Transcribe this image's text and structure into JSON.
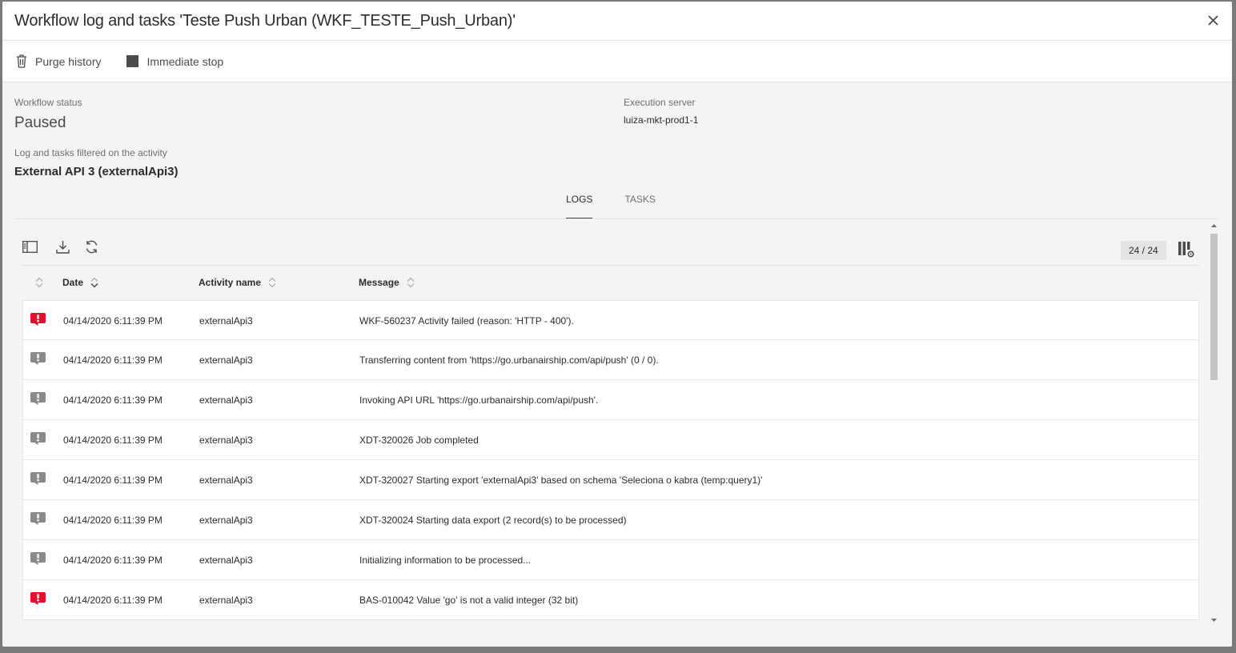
{
  "dialog": {
    "title": "Workflow log and tasks 'Teste Push Urban (WKF_TESTE_Push_Urban)'"
  },
  "toolbar": {
    "purge_label": "Purge history",
    "stop_label": "Immediate stop"
  },
  "info": {
    "status_label": "Workflow status",
    "status_value": "Paused",
    "server_label": "Execution server",
    "server_value": "luiza-mkt-prod1-1",
    "filter_label": "Log and tasks filtered on the activity",
    "filter_value": "External API 3 (externalApi3)"
  },
  "tabs": [
    {
      "label": "LOGS",
      "active": true
    },
    {
      "label": "TASKS",
      "active": false
    }
  ],
  "grid": {
    "count": "24 / 24",
    "columns": {
      "date": "Date",
      "activity": "Activity name",
      "message": "Message"
    },
    "rows": [
      {
        "level": "error",
        "date": "04/14/2020 6:11:39 PM",
        "activity": "externalApi3",
        "message": "WKF-560237 Activity failed (reason: 'HTTP - 400')."
      },
      {
        "level": "info",
        "date": "04/14/2020 6:11:39 PM",
        "activity": "externalApi3",
        "message": "Transferring content from 'https://go.urbanairship.com/api/push' (0 / 0)."
      },
      {
        "level": "info",
        "date": "04/14/2020 6:11:39 PM",
        "activity": "externalApi3",
        "message": "Invoking API URL 'https://go.urbanairship.com/api/push'."
      },
      {
        "level": "info",
        "date": "04/14/2020 6:11:39 PM",
        "activity": "externalApi3",
        "message": "XDT-320026 Job completed"
      },
      {
        "level": "info",
        "date": "04/14/2020 6:11:39 PM",
        "activity": "externalApi3",
        "message": "XDT-320027 Starting export 'externalApi3' based on schema 'Seleciona o kabra (temp:query1)'"
      },
      {
        "level": "info",
        "date": "04/14/2020 6:11:39 PM",
        "activity": "externalApi3",
        "message": "XDT-320024 Starting data export (2 record(s) to be processed)"
      },
      {
        "level": "info",
        "date": "04/14/2020 6:11:39 PM",
        "activity": "externalApi3",
        "message": "Initializing information to be processed..."
      },
      {
        "level": "error",
        "date": "04/14/2020 6:11:39 PM",
        "activity": "externalApi3",
        "message": "BAS-010042 Value 'go' is not a valid integer (32 bit)"
      }
    ]
  },
  "colors": {
    "error": "#e0102e",
    "info": "#8a8a8a"
  },
  "icons": {
    "purge": "trash-icon",
    "stop": "stop-icon",
    "close": "close-icon",
    "panel": "panel-icon",
    "download": "download-icon",
    "refresh": "refresh-icon",
    "columns": "column-settings-icon"
  }
}
